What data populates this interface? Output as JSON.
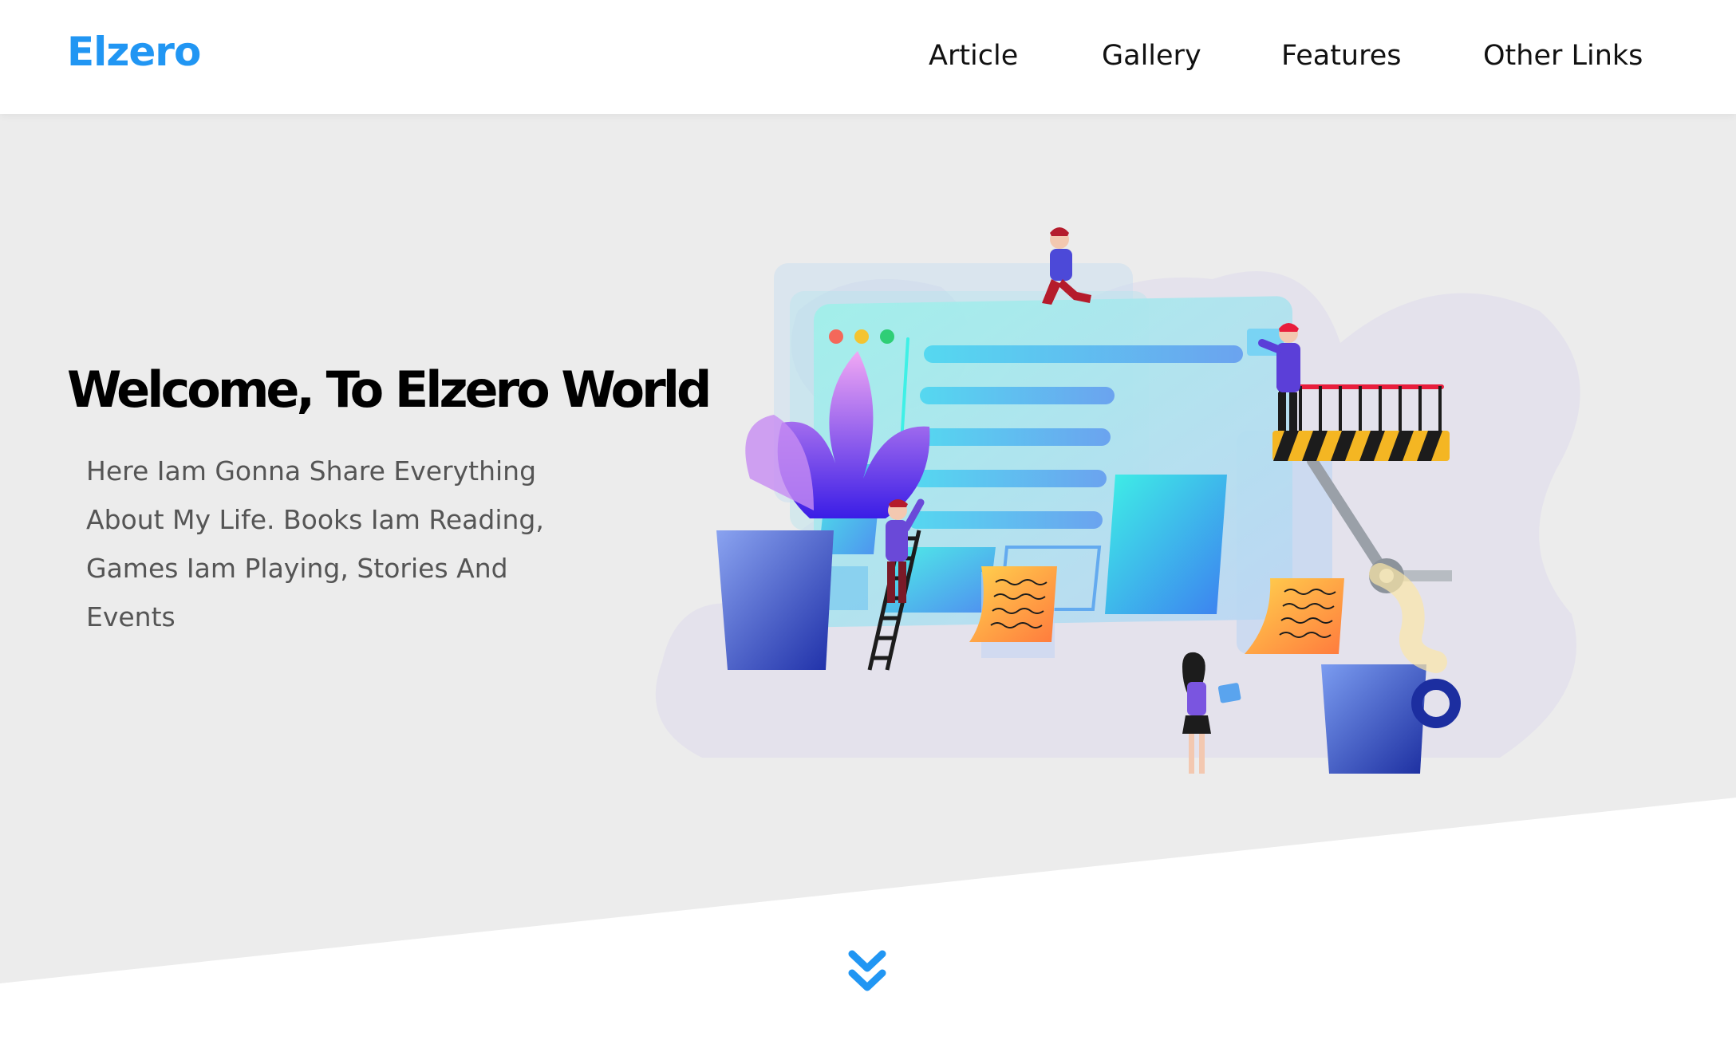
{
  "header": {
    "logo": "Elzero",
    "nav": [
      {
        "label": "Article"
      },
      {
        "label": "Gallery"
      },
      {
        "label": "Features"
      },
      {
        "label": "Other Links"
      }
    ]
  },
  "landing": {
    "title": "Welcome, To Elzero World",
    "paragraph_lines": [
      "Here Iam Gonna Share Everything",
      "About My Life. Books Iam Reading,",
      "Games Iam Playing, Stories And Events"
    ]
  },
  "icons": {
    "scroll_down": "angle-double-down-icon"
  },
  "colors": {
    "brand": "#2196f3",
    "landing_bg": "#ececec"
  }
}
